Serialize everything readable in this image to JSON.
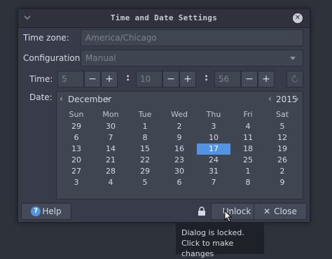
{
  "window": {
    "title": "Time and Date Settings"
  },
  "timezone": {
    "label": "Time zone:",
    "value": "America/Chicago"
  },
  "configuration": {
    "label": "Configuration:",
    "value": "Manual"
  },
  "time": {
    "label": "Time:",
    "hours": "5",
    "minutes": "10",
    "seconds": "56",
    "minus": "−",
    "plus": "+",
    "separator": ":"
  },
  "date": {
    "label": "Date:"
  },
  "calendar": {
    "month": "December",
    "year": "2015",
    "prev": "‹",
    "next": "›",
    "day_names": [
      "Sun",
      "Mon",
      "Tue",
      "Wed",
      "Thu",
      "Fri",
      "Sat"
    ],
    "weeks": [
      [
        "29",
        "30",
        "1",
        "2",
        "3",
        "4",
        "5"
      ],
      [
        "6",
        "7",
        "8",
        "9",
        "10",
        "11",
        "12"
      ],
      [
        "13",
        "14",
        "15",
        "16",
        "17",
        "18",
        "19"
      ],
      [
        "20",
        "21",
        "22",
        "23",
        "24",
        "25",
        "26"
      ],
      [
        "27",
        "28",
        "29",
        "30",
        "31",
        "1",
        "2"
      ],
      [
        "3",
        "4",
        "5",
        "6",
        "7",
        "8",
        "9"
      ]
    ],
    "selected": "17"
  },
  "buttons": {
    "help": "Help",
    "unlock": "Unlock",
    "close": "Close"
  },
  "tooltip": {
    "line1": "Dialog is locked.",
    "line2": "Click to make changes"
  },
  "colors": {
    "accent": "#5294e2",
    "background": "#383c4a"
  }
}
